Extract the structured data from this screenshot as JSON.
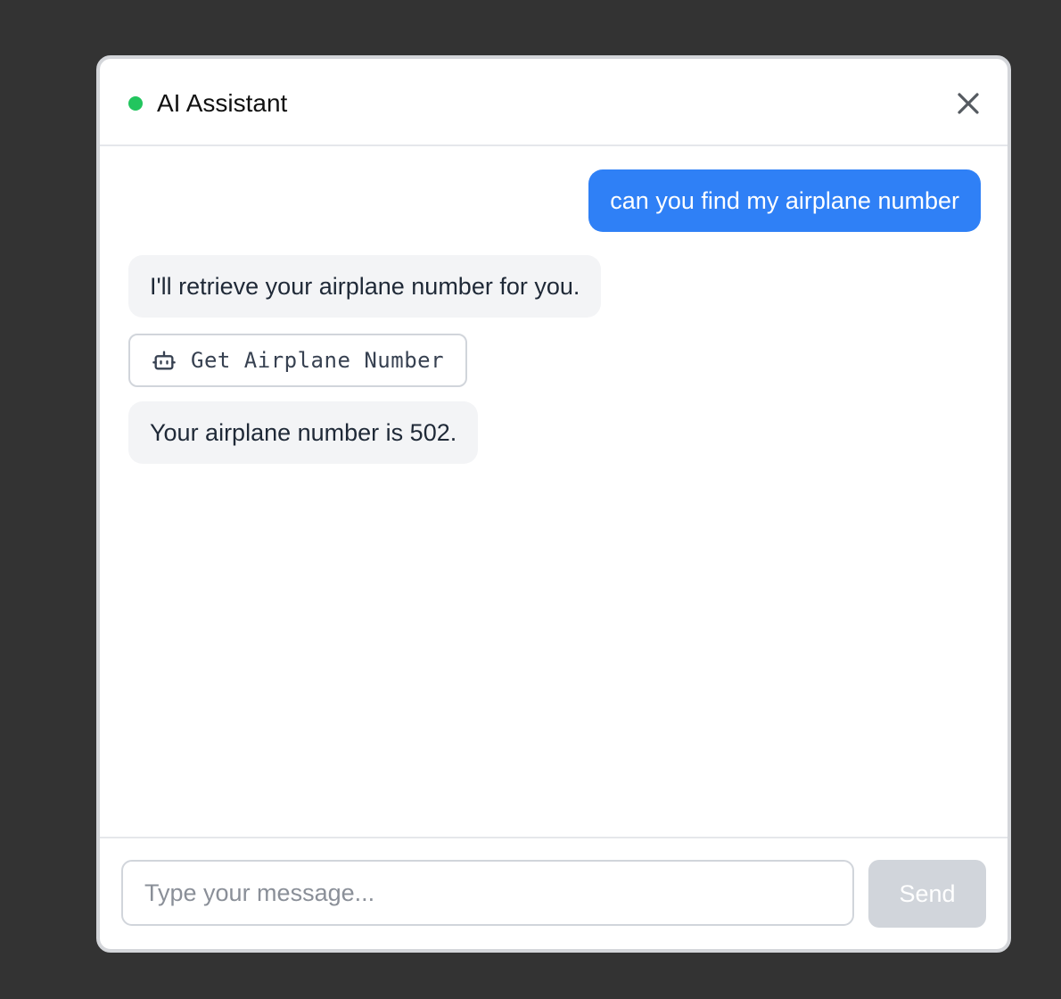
{
  "header": {
    "title": "AI Assistant",
    "status_color": "#22c55e",
    "close_icon": "close-icon"
  },
  "messages": [
    {
      "role": "user",
      "text": "can you find my airplane number"
    },
    {
      "role": "assistant",
      "text": "I'll retrieve your airplane number for you."
    },
    {
      "role": "tool",
      "label": "Get Airplane Number",
      "icon": "robot-icon"
    },
    {
      "role": "assistant",
      "text": "Your airplane number is 502."
    }
  ],
  "composer": {
    "placeholder": "Type your message...",
    "value": "",
    "send_label": "Send"
  },
  "colors": {
    "user_bubble": "#2f80f6",
    "assistant_bubble": "#f3f4f6",
    "send_disabled": "#d1d5db"
  }
}
